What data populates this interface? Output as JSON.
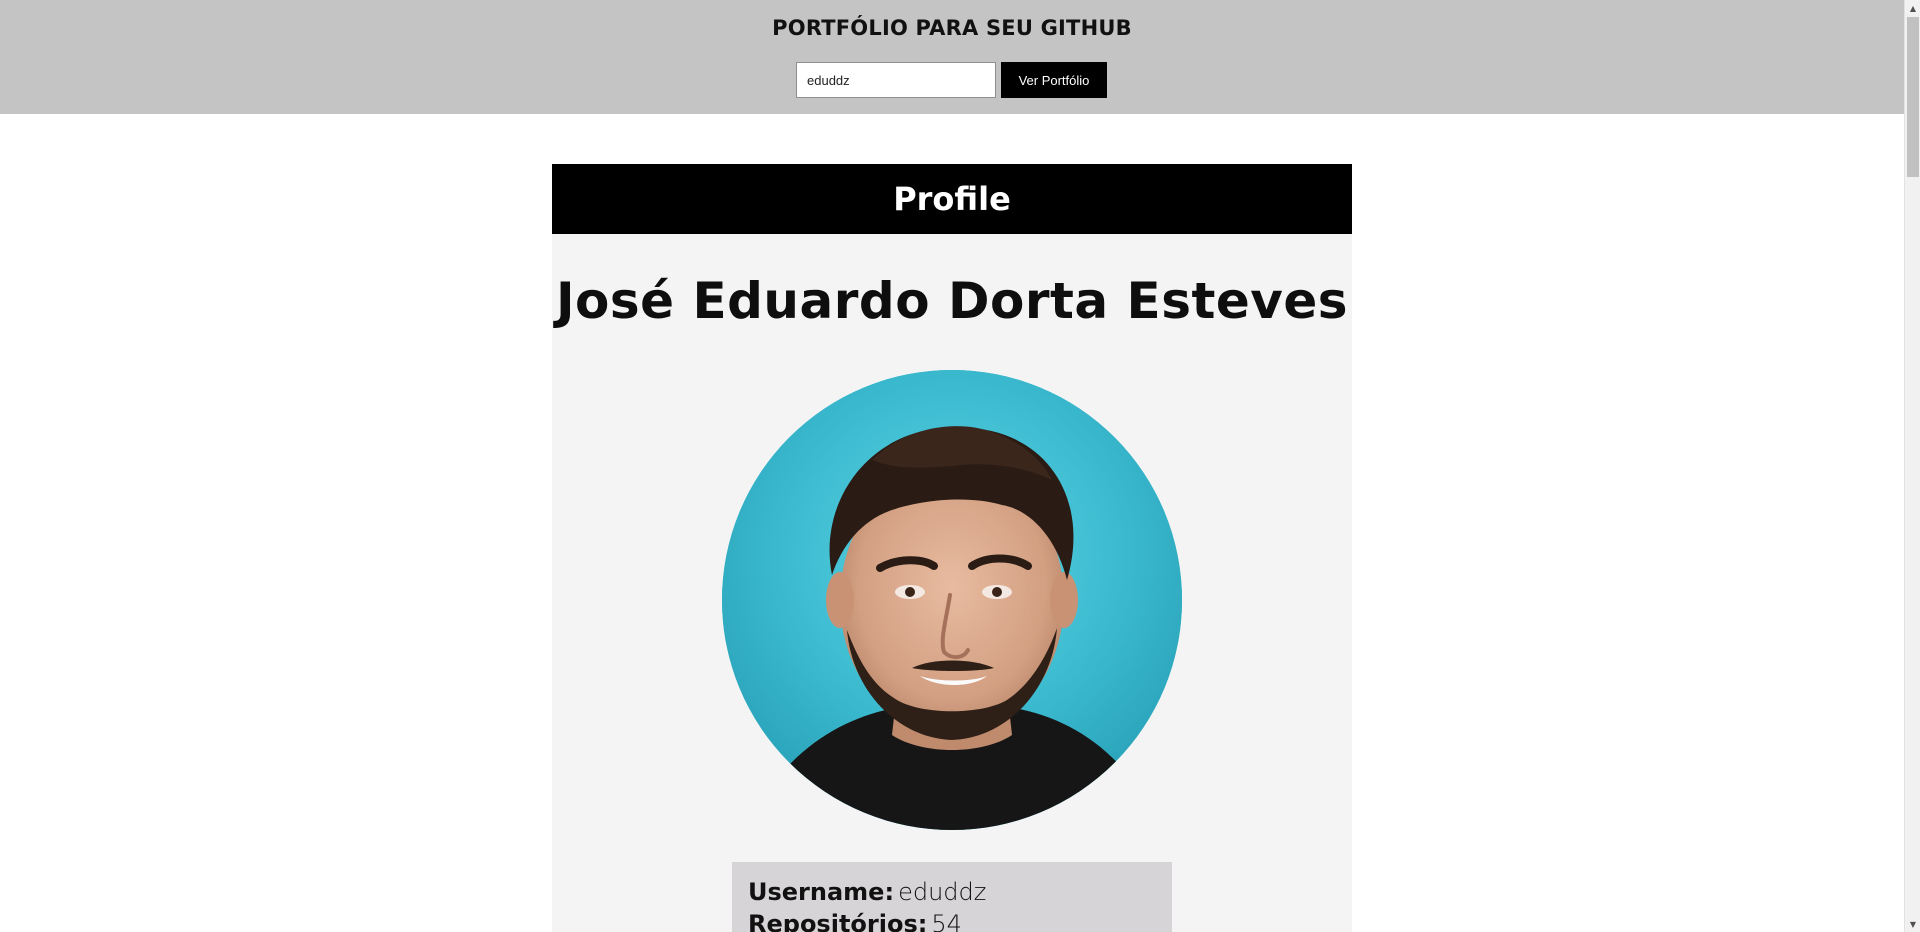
{
  "header": {
    "title": "PORTFÓLIO PARA SEU GITHUB",
    "search_value": "eduddz",
    "button_label": "Ver Portfólio"
  },
  "profile": {
    "section_title": "Profile",
    "full_name": "José Eduardo Dorta Esteves",
    "avatar_icon": "profile-photo",
    "fields": [
      {
        "label": "Username:",
        "value": "eduddz"
      },
      {
        "label": "Repositórios:",
        "value": "54"
      }
    ]
  },
  "colors": {
    "header_bg": "#c4c4c4",
    "card_bg": "#f4f4f5",
    "profile_header_bg": "#000000",
    "info_box_bg": "#d6d4d6",
    "avatar_bg": "#40bfd2"
  }
}
